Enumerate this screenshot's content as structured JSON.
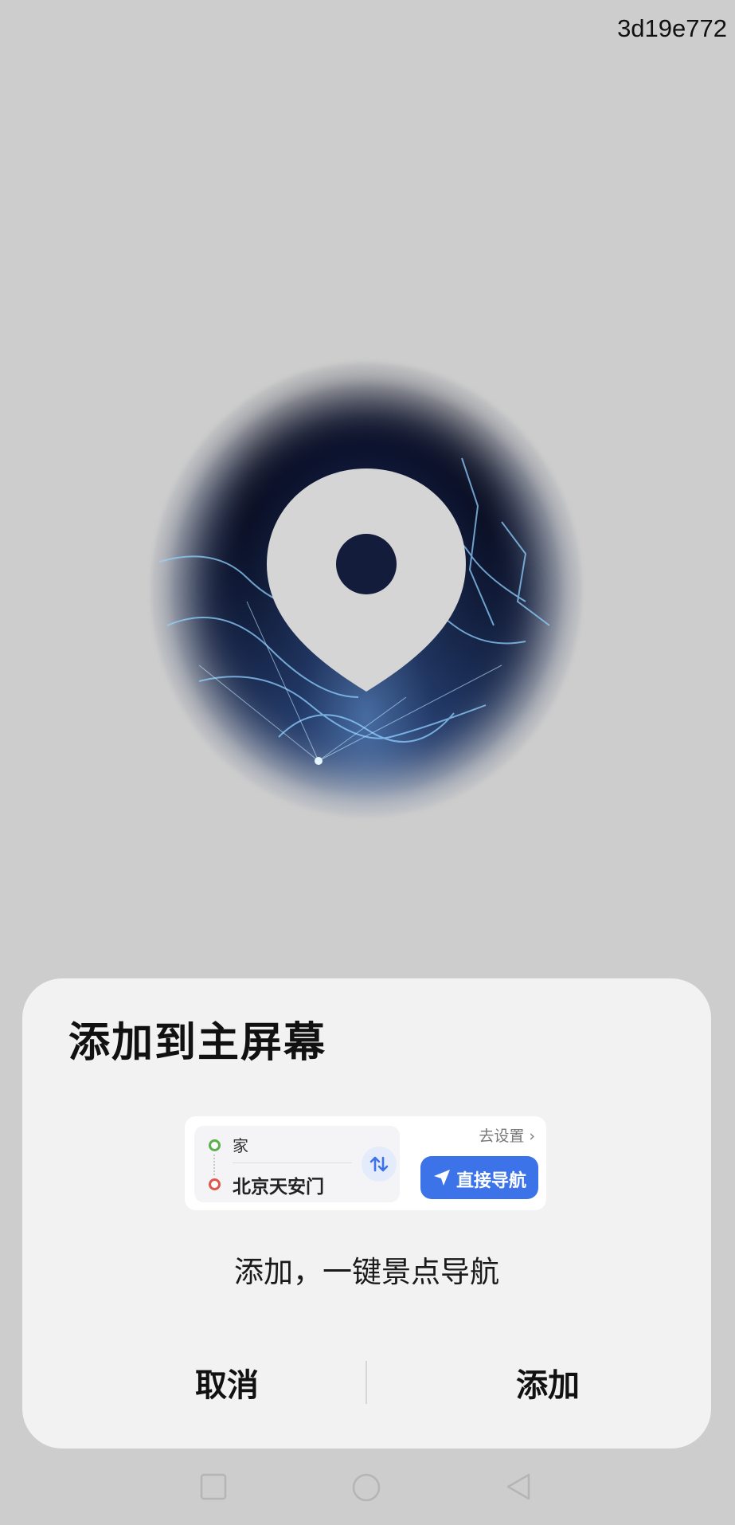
{
  "overlay_id": "3d19e772",
  "splash": {
    "pin_icon": "location-pin-icon",
    "background": "earth-network-image"
  },
  "dialog": {
    "title": "添加到主屏幕",
    "widget": {
      "from": "家",
      "to": "北京天安门",
      "settings_link": "去设置",
      "settings_chevron": "›",
      "navigate_label": "直接导航",
      "swap_icon": "swap-vertical-icon",
      "navigate_icon": "navigation-arrow-icon",
      "colors": {
        "from_dot": "#5ab04a",
        "to_dot": "#e0574a",
        "accent": "#3d73e8"
      }
    },
    "description": "添加，一键景点导航",
    "cancel_label": "取消",
    "add_label": "添加"
  },
  "navbar": {
    "icons": [
      "recent-apps-icon",
      "home-icon",
      "back-icon"
    ]
  }
}
